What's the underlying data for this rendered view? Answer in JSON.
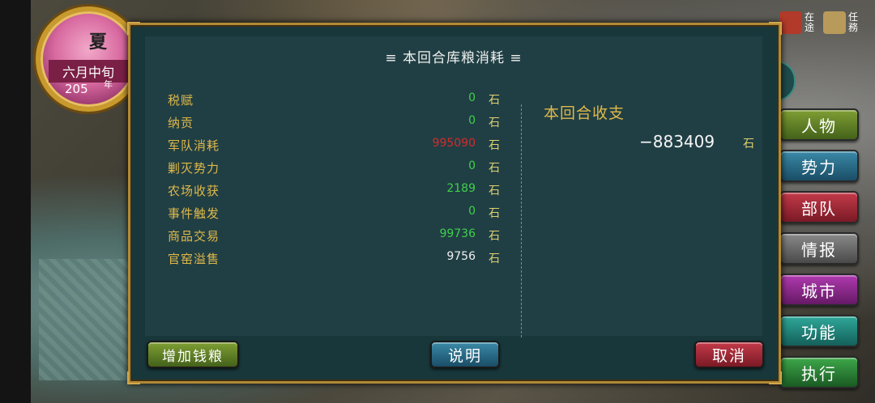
{
  "season": {
    "char": "夏",
    "month": "六月中旬",
    "year": "205",
    "year_unit": "年"
  },
  "top_icons": [
    {
      "name": "en-route",
      "label": "在途",
      "color": "#b23a2a"
    },
    {
      "name": "tasks",
      "label": "任務",
      "color": "#b89a5a"
    }
  ],
  "side_buttons": [
    {
      "label": "人物"
    },
    {
      "label": "势力"
    },
    {
      "label": "部队"
    },
    {
      "label": "情报"
    },
    {
      "label": "城市"
    },
    {
      "label": "功能"
    },
    {
      "label": "执行"
    }
  ],
  "dialog": {
    "title": "≡ 本回合库粮消耗 ≡",
    "unit": "石",
    "rows": [
      {
        "label": "税赋",
        "value": "0",
        "color": "green"
      },
      {
        "label": "纳贡",
        "value": "0",
        "color": "green"
      },
      {
        "label": "军队消耗",
        "value": "995090",
        "color": "red"
      },
      {
        "label": "剿灭势力",
        "value": "0",
        "color": "green"
      },
      {
        "label": "农场收获",
        "value": "2189",
        "color": "green"
      },
      {
        "label": "事件触发",
        "value": "0",
        "color": "green"
      },
      {
        "label": "商品交易",
        "value": "99736",
        "color": "green"
      },
      {
        "label": "官窑溢售",
        "value": "9756",
        "color": "white"
      }
    ],
    "summary_label": "本回合收支",
    "summary_value": "−883409",
    "summary_unit": "石",
    "buttons": {
      "add": "增加钱粮",
      "help": "说明",
      "cancel": "取消"
    }
  }
}
